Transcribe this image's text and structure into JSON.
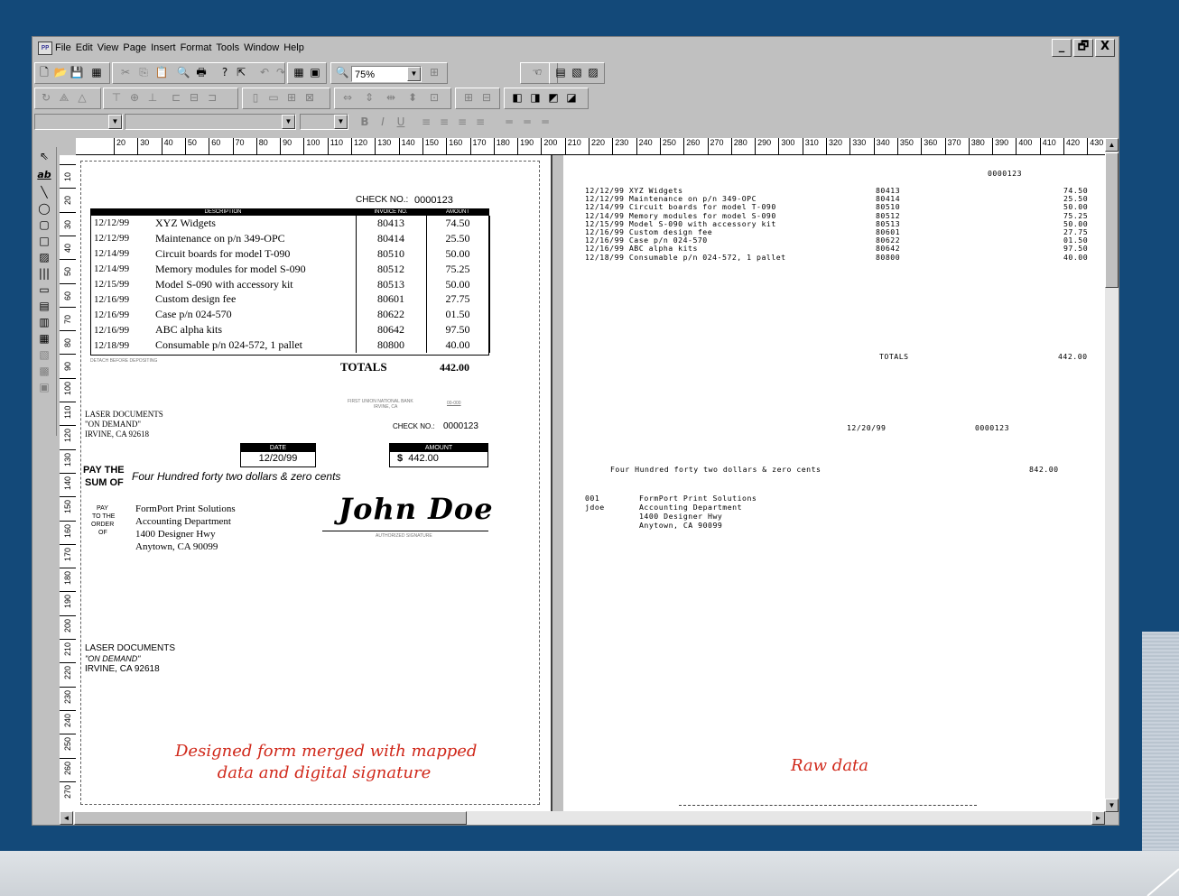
{
  "menu": [
    "File",
    "Edit",
    "View",
    "Page",
    "Insert",
    "Format",
    "Tools",
    "Window",
    "Help"
  ],
  "window_buttons": [
    "_",
    "🗗",
    "X"
  ],
  "toolbar": {
    "zoom": "75%",
    "bold": "B",
    "italic": "I",
    "underline": "U"
  },
  "icons": [
    "new-icon",
    "open-icon",
    "save-icon",
    "print-preview-icon",
    "print-icon",
    "help-icon",
    "undo-icon",
    "redo-icon",
    "zoom-icon",
    "hand-icon"
  ],
  "ruler_h": [
    "20",
    "30",
    "40",
    "50",
    "60",
    "70",
    "80",
    "90",
    "100",
    "110",
    "120",
    "130",
    "140",
    "150",
    "160",
    "170",
    "180",
    "190",
    "200",
    "210",
    "220",
    "230",
    "240",
    "250",
    "260",
    "270",
    "280",
    "290",
    "300",
    "310",
    "320",
    "330",
    "340",
    "350",
    "360",
    "370",
    "380",
    "390",
    "400",
    "410",
    "420",
    "430",
    "4"
  ],
  "ruler_v": [
    "10",
    "20",
    "30",
    "40",
    "50",
    "60",
    "70",
    "80",
    "90",
    "100",
    "110",
    "120",
    "130",
    "140",
    "150",
    "160",
    "170",
    "180",
    "190",
    "200",
    "210",
    "220",
    "230",
    "240",
    "250",
    "260",
    "270"
  ],
  "form": {
    "check_no_label": "CHECK NO.:",
    "check_no": "0000123",
    "headers": {
      "description": "DESCRIPTION",
      "invoice": "INVOICE NO.",
      "amount": "AMOUNT"
    },
    "rows": [
      {
        "date": "12/12/99",
        "desc": "XYZ Widgets",
        "inv": "80413",
        "amt": "74.50"
      },
      {
        "date": "12/12/99",
        "desc": "Maintenance on p/n 349-OPC",
        "inv": "80414",
        "amt": "25.50"
      },
      {
        "date": "12/14/99",
        "desc": "Circuit boards for model T-090",
        "inv": "80510",
        "amt": "50.00"
      },
      {
        "date": "12/14/99",
        "desc": "Memory modules for model S-090",
        "inv": "80512",
        "amt": "75.25"
      },
      {
        "date": "12/15/99",
        "desc": "Model S-090 with accessory kit",
        "inv": "80513",
        "amt": "50.00"
      },
      {
        "date": "12/16/99",
        "desc": "Custom design fee",
        "inv": "80601",
        "amt": "27.75"
      },
      {
        "date": "12/16/99",
        "desc": "Case p/n 024-570",
        "inv": "80622",
        "amt": "01.50"
      },
      {
        "date": "12/16/99",
        "desc": "ABC alpha kits",
        "inv": "80642",
        "amt": "97.50"
      },
      {
        "date": "12/18/99",
        "desc": "Consumable p/n 024-572, 1 pallet",
        "inv": "80800",
        "amt": "40.00"
      }
    ],
    "detach_text": "DETACH BEFORE DEPOSITING",
    "totals_label": "TOTALS",
    "total": "442.00",
    "bank_name": "FIRST UNION NATIONAL BANK",
    "bank_city": "IRVINE, CA",
    "bank_code": "00-000",
    "company_line1": "LASER DOCUMENTS",
    "company_line2": "\"ON DEMAND\"",
    "company_line3": "IRVINE, CA 92618",
    "check_no_label2": "CHECK NO.:",
    "date_label": "DATE",
    "date": "12/20/99",
    "amount_label": "AMOUNT",
    "amount_symbol": "$",
    "amount": "442.00",
    "pay_the_1": "PAY THE",
    "pay_the_2": "SUM OF",
    "amount_words": "Four Hundred forty two dollars & zero cents",
    "pay_to_1": "PAY",
    "pay_to_2": "TO THE",
    "pay_to_3": "ORDER",
    "pay_to_4": "OF",
    "payee": [
      "FormPort Print Solutions",
      "Accounting Department",
      "1400 Designer Hwy",
      "Anytown, CA 90099"
    ],
    "signature": "John Doe",
    "auth_sig_label": "AUTHORIZED SIGNATURE",
    "footer_line1": "LASER DOCUMENTS",
    "footer_line2": "\"ON DEMAND\"",
    "footer_line3": "IRVINE, CA 92618",
    "caption_line1": "Designed form merged with mapped",
    "caption_line2": "data and digital signature"
  },
  "raw": {
    "check_no": "0000123",
    "rows": [
      "12/12/99 XYZ Widgets",
      "12/12/99 Maintenance on p/n 349-OPC",
      "12/14/99 Circuit boards for model T-090",
      "12/14/99 Memory modules for model S-090",
      "12/15/99 Model S-090 with accessory kit",
      "12/16/99 Custom design fee",
      "12/16/99 Case p/n 024-570",
      "12/16/99 ABC alpha kits",
      "12/18/99 Consumable p/n 024-572, 1 pallet"
    ],
    "invoices": [
      "80413",
      "80414",
      "80510",
      "80512",
      "80513",
      "80601",
      "80622",
      "80642",
      "80800"
    ],
    "amounts": [
      "74.50",
      "25.50",
      "50.00",
      "75.25",
      "50.00",
      "27.75",
      "01.50",
      "97.50",
      "40.00"
    ],
    "totals_label": "TOTALS",
    "total": "442.00",
    "date": "12/20/99",
    "check_no2": "0000123",
    "words": "Four Hundred forty two dollars & zero cents",
    "amount_words_value": "842.00",
    "addr_codes": [
      "001",
      "jdoe"
    ],
    "addr_lines": [
      "FormPort Print Solutions",
      "Accounting Department",
      "1400 Designer Hwy",
      "Anytown, CA 90099"
    ],
    "caption": "Raw data"
  }
}
